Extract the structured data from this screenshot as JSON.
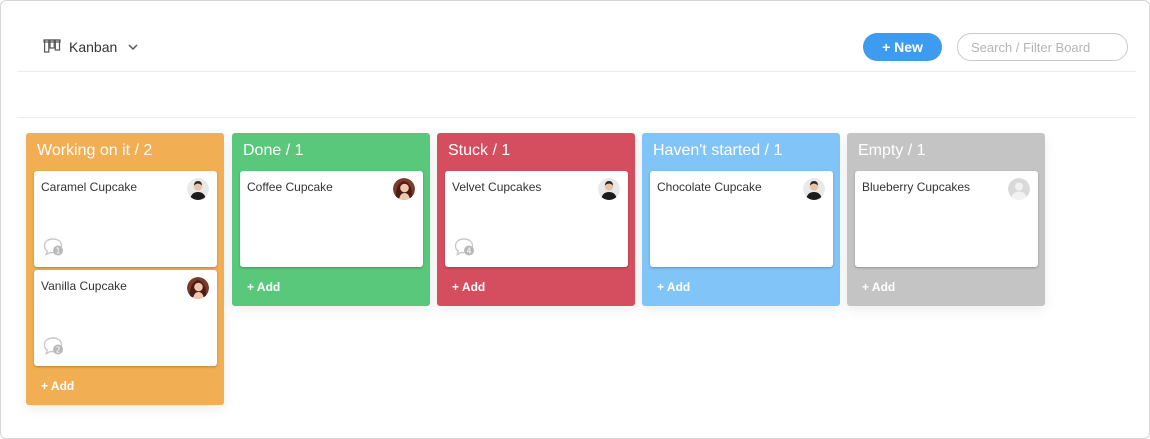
{
  "header": {
    "view_label": "Kanban",
    "view_icon": "kanban-icon",
    "new_button_label": "+ New",
    "search_placeholder": "Search / Filter Board"
  },
  "colors": {
    "working": "#f2ae53",
    "done": "#5ac87a",
    "stuck": "#d44e5f",
    "not_started": "#81c4f7",
    "empty": "#c4c4c4",
    "accent": "#3d9cf0"
  },
  "columns": [
    {
      "title": "Working on it / 2",
      "add_label": "+ Add",
      "cards": [
        {
          "title": "Caramel Cupcake",
          "comment_count": "1",
          "avatar": "male-avatar"
        },
        {
          "title": "Vanilla Cupcake",
          "comment_count": "2",
          "avatar": "female-avatar"
        }
      ]
    },
    {
      "title": "Done / 1",
      "add_label": "+ Add",
      "cards": [
        {
          "title": "Coffee Cupcake",
          "avatar": "female-avatar"
        }
      ]
    },
    {
      "title": "Stuck / 1",
      "add_label": "+ Add",
      "cards": [
        {
          "title": "Velvet Cupcakes",
          "comment_count": "4",
          "avatar": "male-avatar"
        }
      ]
    },
    {
      "title": "Haven't started / 1",
      "add_label": "+ Add",
      "cards": [
        {
          "title": "Chocolate Cupcake",
          "avatar": "male-avatar"
        }
      ]
    },
    {
      "title": "Empty / 1",
      "add_label": "+ Add",
      "cards": [
        {
          "title": "Blueberry Cupcakes",
          "avatar": "empty-avatar"
        }
      ]
    }
  ]
}
